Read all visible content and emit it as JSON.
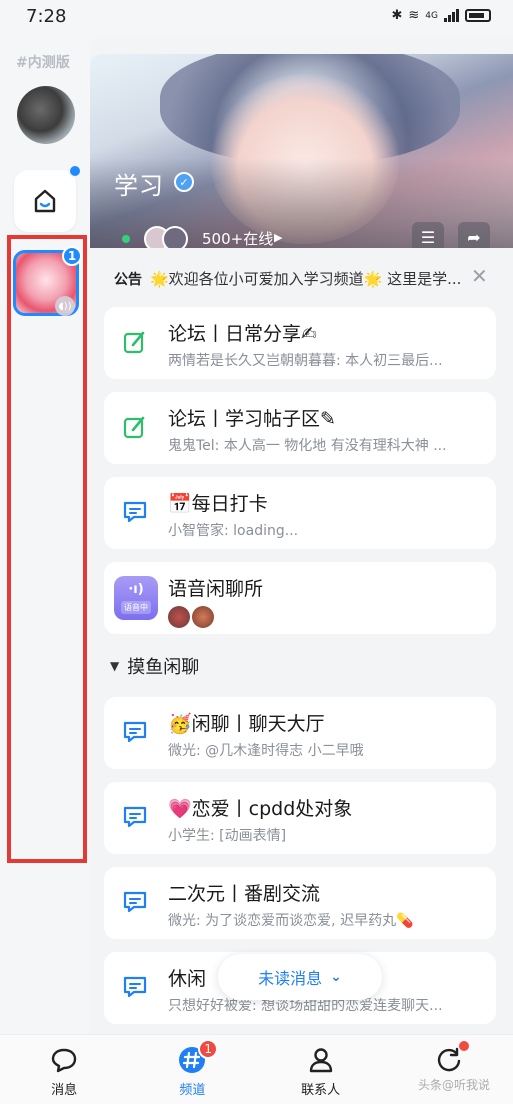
{
  "status_bar": {
    "time": "7:28",
    "network": "4G"
  },
  "rail": {
    "tag": "#内测版",
    "channel_badge": "1"
  },
  "channel": {
    "title": "学习",
    "online_count": "500+在线",
    "announcement_label": "公告",
    "announcement_text": "🌟欢迎各位小可爱加入学习频道🌟 这里是学..."
  },
  "cards": [
    {
      "title": "论坛丨日常分享✍",
      "subtitle": "两情若是长久又岂朝朝暮暮: 本人初三最后..."
    },
    {
      "title": "论坛丨学习帖子区✎",
      "subtitle": "鬼鬼Tel: 本人高一 物化地 有没有理科大神 ..."
    },
    {
      "title": "📅每日打卡",
      "subtitle": "小智管家: loading..."
    },
    {
      "title": "语音闲聊所",
      "voice_tag": "语音中"
    }
  ],
  "section": {
    "label": "摸鱼闲聊"
  },
  "section_cards": [
    {
      "title": "🥳闲聊丨聊天大厅",
      "subtitle": "微光: @几木逢时得志 小二早哦"
    },
    {
      "title": "💗恋爱丨cpdd处对象",
      "subtitle": "小学生: [动画表情]"
    },
    {
      "title": "二次元丨番剧交流",
      "subtitle": "微光: 为了谈恋爱而谈恋爱, 迟早药丸💊"
    },
    {
      "title": "休闲",
      "subtitle": "只想好好被爱: 想谈场甜甜的恋爱连麦聊天..."
    }
  ],
  "unread": {
    "label": "未读消息"
  },
  "nav": [
    {
      "label": "消息"
    },
    {
      "label": "频道",
      "badge": "1"
    },
    {
      "label": "联系人"
    },
    {
      "label": ""
    }
  ],
  "watermark": "头条@听我说",
  "colors": {
    "accent": "#1f7ff5",
    "badge_red": "#f04a41",
    "highlight_frame": "#e53935",
    "online_green": "#36d07a"
  }
}
